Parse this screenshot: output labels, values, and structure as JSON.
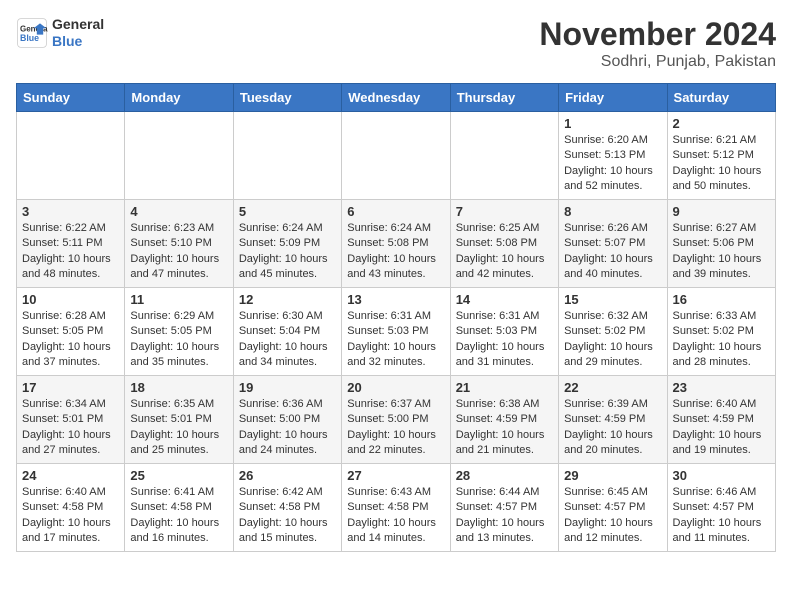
{
  "header": {
    "logo_line1": "General",
    "logo_line2": "Blue",
    "month": "November 2024",
    "location": "Sodhri, Punjab, Pakistan"
  },
  "days_of_week": [
    "Sunday",
    "Monday",
    "Tuesday",
    "Wednesday",
    "Thursday",
    "Friday",
    "Saturday"
  ],
  "weeks": [
    [
      {
        "day": "",
        "info": ""
      },
      {
        "day": "",
        "info": ""
      },
      {
        "day": "",
        "info": ""
      },
      {
        "day": "",
        "info": ""
      },
      {
        "day": "",
        "info": ""
      },
      {
        "day": "1",
        "info": "Sunrise: 6:20 AM\nSunset: 5:13 PM\nDaylight: 10 hours and 52 minutes."
      },
      {
        "day": "2",
        "info": "Sunrise: 6:21 AM\nSunset: 5:12 PM\nDaylight: 10 hours and 50 minutes."
      }
    ],
    [
      {
        "day": "3",
        "info": "Sunrise: 6:22 AM\nSunset: 5:11 PM\nDaylight: 10 hours and 48 minutes."
      },
      {
        "day": "4",
        "info": "Sunrise: 6:23 AM\nSunset: 5:10 PM\nDaylight: 10 hours and 47 minutes."
      },
      {
        "day": "5",
        "info": "Sunrise: 6:24 AM\nSunset: 5:09 PM\nDaylight: 10 hours and 45 minutes."
      },
      {
        "day": "6",
        "info": "Sunrise: 6:24 AM\nSunset: 5:08 PM\nDaylight: 10 hours and 43 minutes."
      },
      {
        "day": "7",
        "info": "Sunrise: 6:25 AM\nSunset: 5:08 PM\nDaylight: 10 hours and 42 minutes."
      },
      {
        "day": "8",
        "info": "Sunrise: 6:26 AM\nSunset: 5:07 PM\nDaylight: 10 hours and 40 minutes."
      },
      {
        "day": "9",
        "info": "Sunrise: 6:27 AM\nSunset: 5:06 PM\nDaylight: 10 hours and 39 minutes."
      }
    ],
    [
      {
        "day": "10",
        "info": "Sunrise: 6:28 AM\nSunset: 5:05 PM\nDaylight: 10 hours and 37 minutes."
      },
      {
        "day": "11",
        "info": "Sunrise: 6:29 AM\nSunset: 5:05 PM\nDaylight: 10 hours and 35 minutes."
      },
      {
        "day": "12",
        "info": "Sunrise: 6:30 AM\nSunset: 5:04 PM\nDaylight: 10 hours and 34 minutes."
      },
      {
        "day": "13",
        "info": "Sunrise: 6:31 AM\nSunset: 5:03 PM\nDaylight: 10 hours and 32 minutes."
      },
      {
        "day": "14",
        "info": "Sunrise: 6:31 AM\nSunset: 5:03 PM\nDaylight: 10 hours and 31 minutes."
      },
      {
        "day": "15",
        "info": "Sunrise: 6:32 AM\nSunset: 5:02 PM\nDaylight: 10 hours and 29 minutes."
      },
      {
        "day": "16",
        "info": "Sunrise: 6:33 AM\nSunset: 5:02 PM\nDaylight: 10 hours and 28 minutes."
      }
    ],
    [
      {
        "day": "17",
        "info": "Sunrise: 6:34 AM\nSunset: 5:01 PM\nDaylight: 10 hours and 27 minutes."
      },
      {
        "day": "18",
        "info": "Sunrise: 6:35 AM\nSunset: 5:01 PM\nDaylight: 10 hours and 25 minutes."
      },
      {
        "day": "19",
        "info": "Sunrise: 6:36 AM\nSunset: 5:00 PM\nDaylight: 10 hours and 24 minutes."
      },
      {
        "day": "20",
        "info": "Sunrise: 6:37 AM\nSunset: 5:00 PM\nDaylight: 10 hours and 22 minutes."
      },
      {
        "day": "21",
        "info": "Sunrise: 6:38 AM\nSunset: 4:59 PM\nDaylight: 10 hours and 21 minutes."
      },
      {
        "day": "22",
        "info": "Sunrise: 6:39 AM\nSunset: 4:59 PM\nDaylight: 10 hours and 20 minutes."
      },
      {
        "day": "23",
        "info": "Sunrise: 6:40 AM\nSunset: 4:59 PM\nDaylight: 10 hours and 19 minutes."
      }
    ],
    [
      {
        "day": "24",
        "info": "Sunrise: 6:40 AM\nSunset: 4:58 PM\nDaylight: 10 hours and 17 minutes."
      },
      {
        "day": "25",
        "info": "Sunrise: 6:41 AM\nSunset: 4:58 PM\nDaylight: 10 hours and 16 minutes."
      },
      {
        "day": "26",
        "info": "Sunrise: 6:42 AM\nSunset: 4:58 PM\nDaylight: 10 hours and 15 minutes."
      },
      {
        "day": "27",
        "info": "Sunrise: 6:43 AM\nSunset: 4:58 PM\nDaylight: 10 hours and 14 minutes."
      },
      {
        "day": "28",
        "info": "Sunrise: 6:44 AM\nSunset: 4:57 PM\nDaylight: 10 hours and 13 minutes."
      },
      {
        "day": "29",
        "info": "Sunrise: 6:45 AM\nSunset: 4:57 PM\nDaylight: 10 hours and 12 minutes."
      },
      {
        "day": "30",
        "info": "Sunrise: 6:46 AM\nSunset: 4:57 PM\nDaylight: 10 hours and 11 minutes."
      }
    ]
  ]
}
